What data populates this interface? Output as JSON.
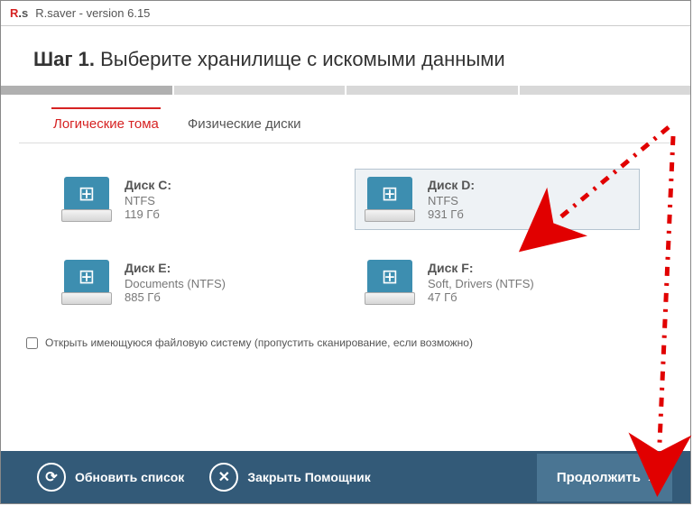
{
  "title": {
    "logo_r": "R",
    "logo_dot": ".",
    "logo_s": "s",
    "text": "R.saver - version 6.15"
  },
  "header": {
    "step_bold": "Шаг 1.",
    "step_rest": " Выберите хранилище с искомыми данными"
  },
  "tabs": {
    "logical": "Логические тома",
    "physical": "Физические диски"
  },
  "disks": [
    {
      "name": "Диск C:",
      "fs": "NTFS",
      "size": "119 Гб",
      "selected": false
    },
    {
      "name": "Диск D:",
      "fs": "NTFS",
      "size": "931 Гб",
      "selected": true
    },
    {
      "name": "Диск E:",
      "fs": "Documents (NTFS)",
      "size": "885 Гб",
      "selected": false
    },
    {
      "name": "Диск F:",
      "fs": "Soft, Drivers (NTFS)",
      "size": "47 Гб",
      "selected": false
    }
  ],
  "checkbox": {
    "label": "Открыть имеющуюся файловую систему (пропустить сканирование, если возможно)",
    "checked": false
  },
  "footer": {
    "refresh": "Обновить список",
    "close": "Закрыть Помощник",
    "continue": "Продолжить"
  }
}
